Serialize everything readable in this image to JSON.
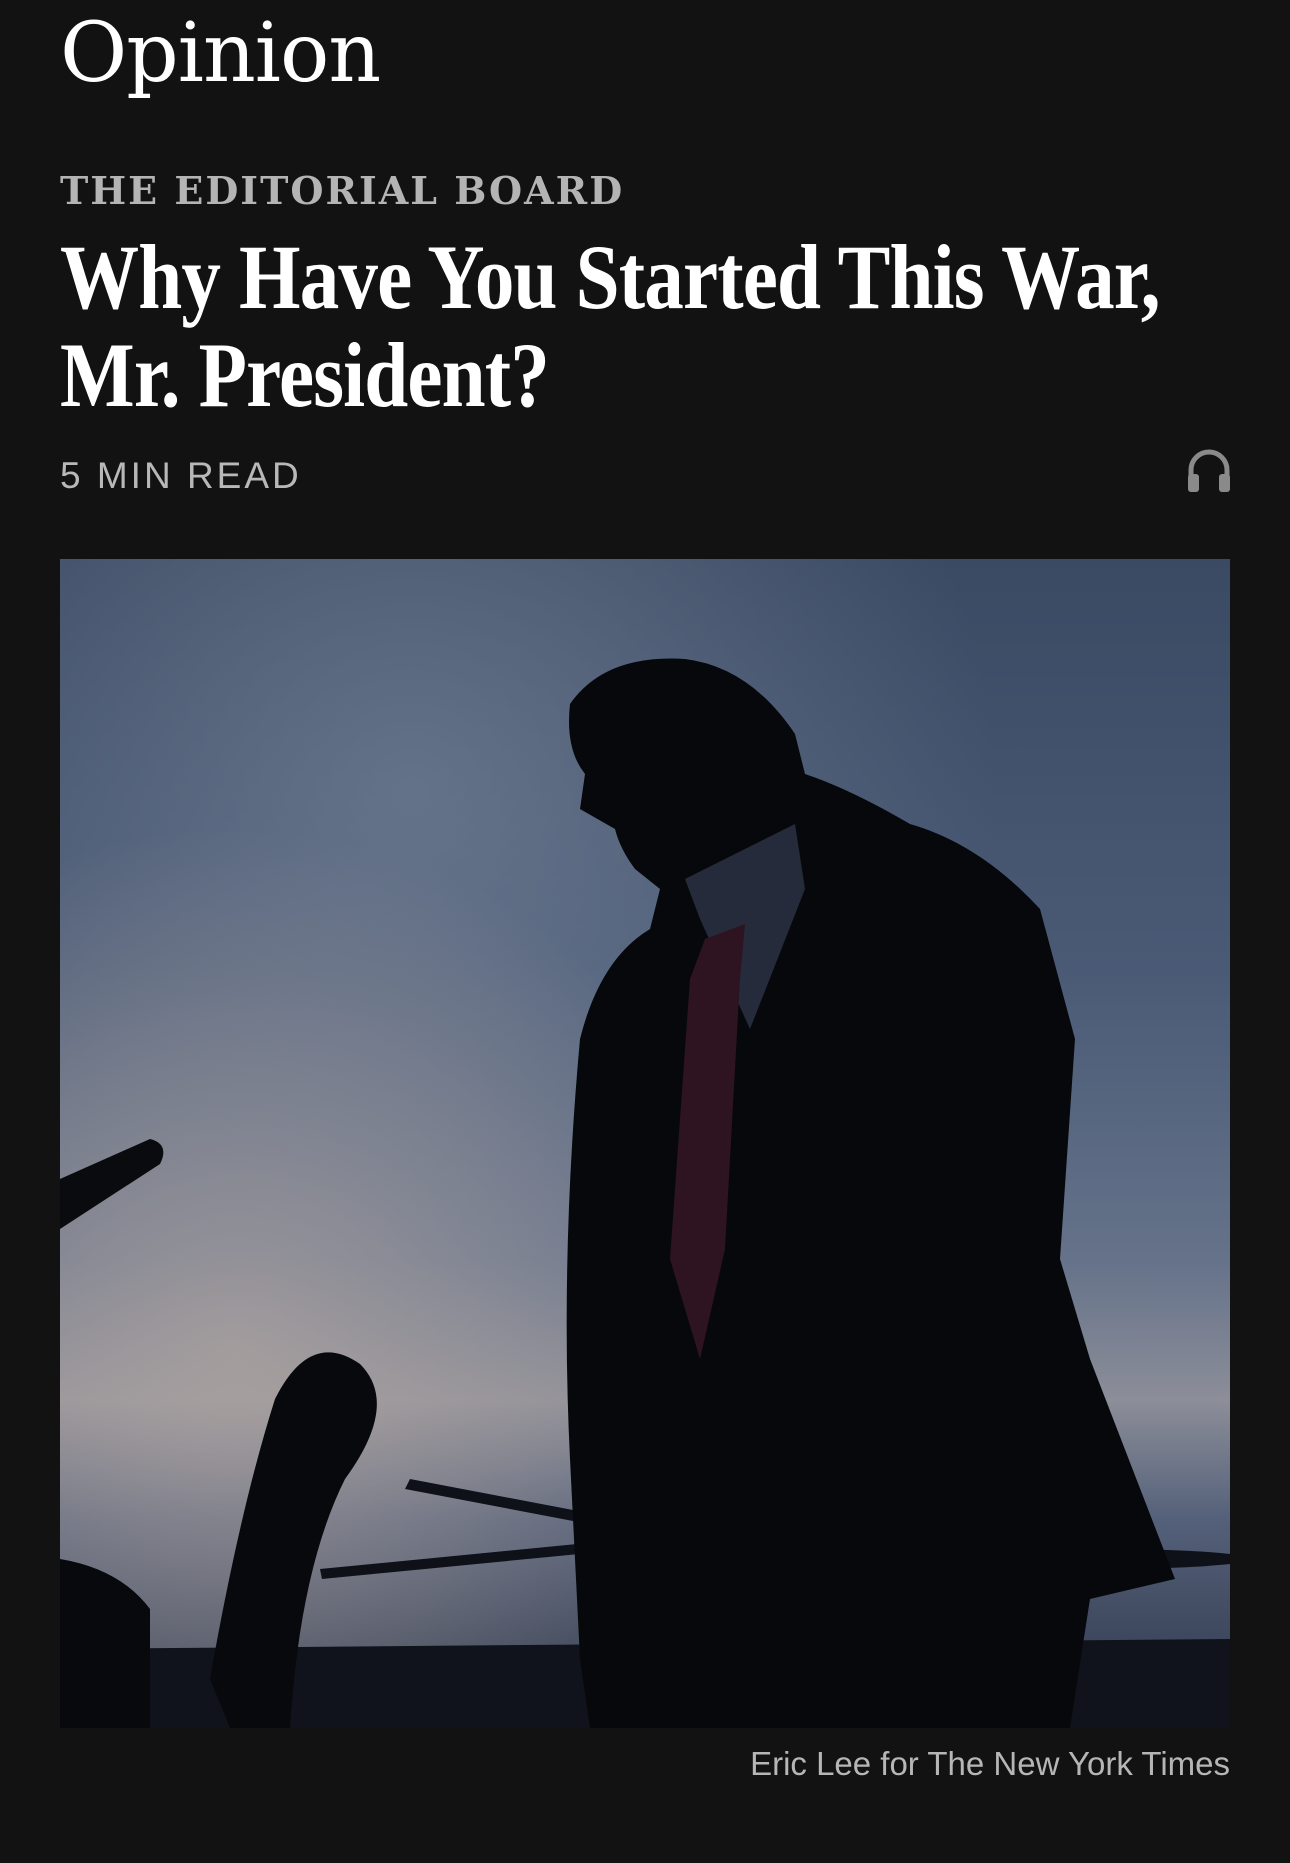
{
  "section": {
    "label": "Opinion"
  },
  "article": {
    "kicker": "THE EDITORIAL BOARD",
    "headline": "Why Have You Started This War, Mr. President?",
    "read_time": "5 MIN READ",
    "listen_icon": "headphones-icon",
    "photo_credit": "Eric Lee for The New York Times"
  },
  "colors": {
    "background": "#121212",
    "text": "#ffffff",
    "muted": "#b4b4b4"
  }
}
